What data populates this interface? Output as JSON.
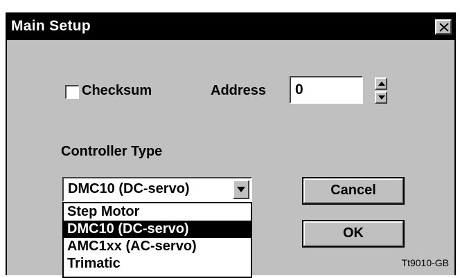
{
  "window": {
    "title": "Main Setup",
    "close_label": "×"
  },
  "options": {
    "checksum_label": "Checksum",
    "checksum_checked": false,
    "address_label": "Address",
    "address_value": "0"
  },
  "controller": {
    "label": "Controller Type",
    "selected": "DMC10 (DC-servo)",
    "options": [
      "Step Motor",
      "DMC10 (DC-servo)",
      "AMC1xx (AC-servo)",
      "Trimatic"
    ],
    "selected_index": 1
  },
  "buttons": {
    "cancel": "Cancel",
    "ok": "OK"
  },
  "figure_ref": "Tt9010-GB"
}
